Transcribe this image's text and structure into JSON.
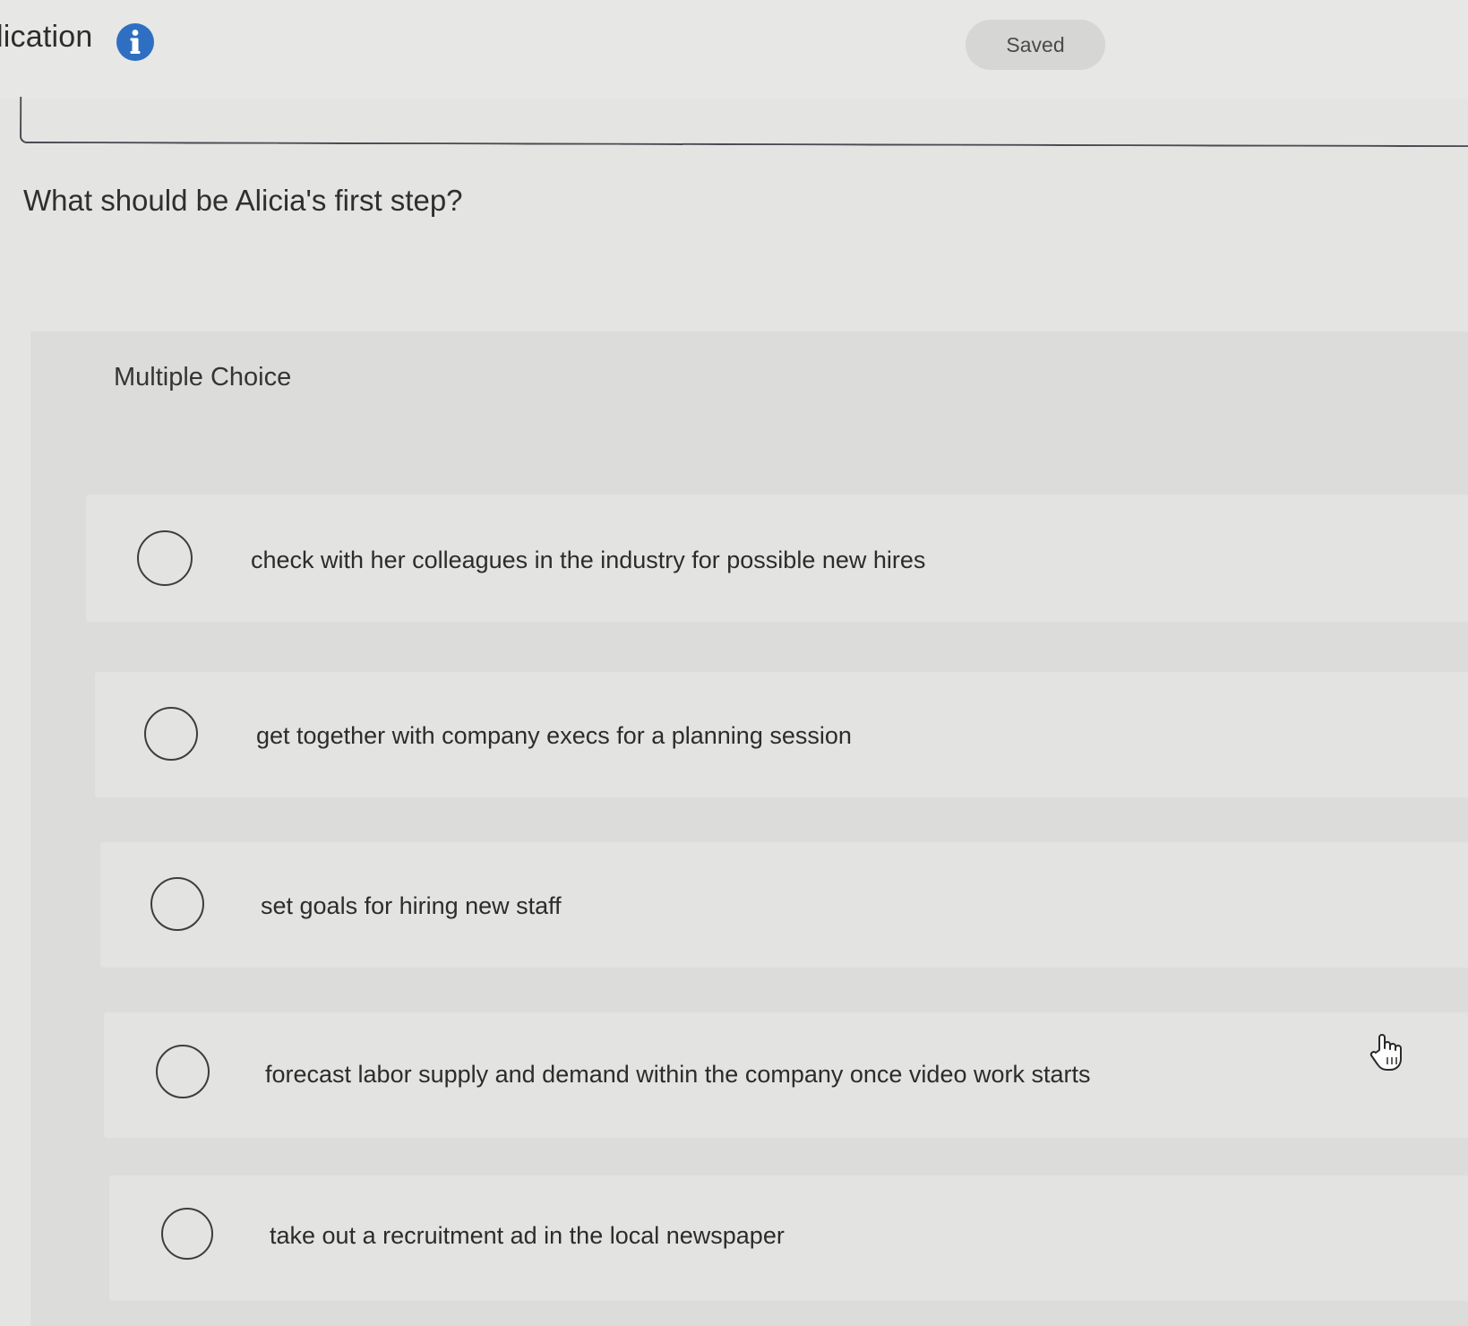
{
  "header": {
    "title_fragment": "lication",
    "info_icon": "info-icon",
    "status": "Saved"
  },
  "question": {
    "prompt": "What should be Alicia's first step?",
    "type_label": "Multiple Choice",
    "options": [
      {
        "label": "check with her colleagues in the industry for possible new hires",
        "selected": false
      },
      {
        "label": "get together with company execs for a planning session",
        "selected": false
      },
      {
        "label": "set goals for hiring new staff",
        "selected": false
      },
      {
        "label": "forecast labor supply and demand within the company once video work starts",
        "selected": false
      },
      {
        "label": "take out a recruitment ad in the local newspaper",
        "selected": false
      }
    ]
  },
  "colors": {
    "info_icon": "#2f6fc2",
    "radio_border": "#3d3d3d",
    "background": "#e4e4e2"
  },
  "cursor": "hand-pointer-icon"
}
